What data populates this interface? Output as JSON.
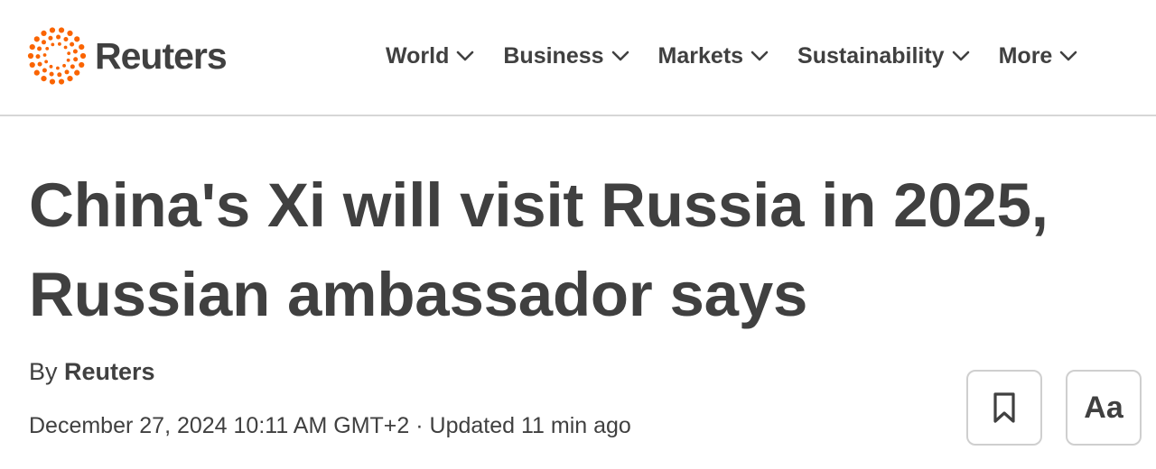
{
  "brand": {
    "name": "Reuters",
    "accent_color": "#fa6400"
  },
  "nav": {
    "items": [
      {
        "label": "World"
      },
      {
        "label": "Business"
      },
      {
        "label": "Markets"
      },
      {
        "label": "Sustainability"
      },
      {
        "label": "More"
      }
    ]
  },
  "article": {
    "headline": "China's Xi will visit Russia in 2025, Russian ambassador says",
    "byline_prefix": "By ",
    "author": "Reuters",
    "published": "December 27, 2024 10:11 AM GMT+2",
    "separator": " · ",
    "updated": "Updated 11 min ago"
  },
  "tools": {
    "bookmark_icon": "bookmark-icon",
    "text_size_label": "Aa"
  },
  "colors": {
    "text": "#404040",
    "border": "#cfcfcf"
  }
}
